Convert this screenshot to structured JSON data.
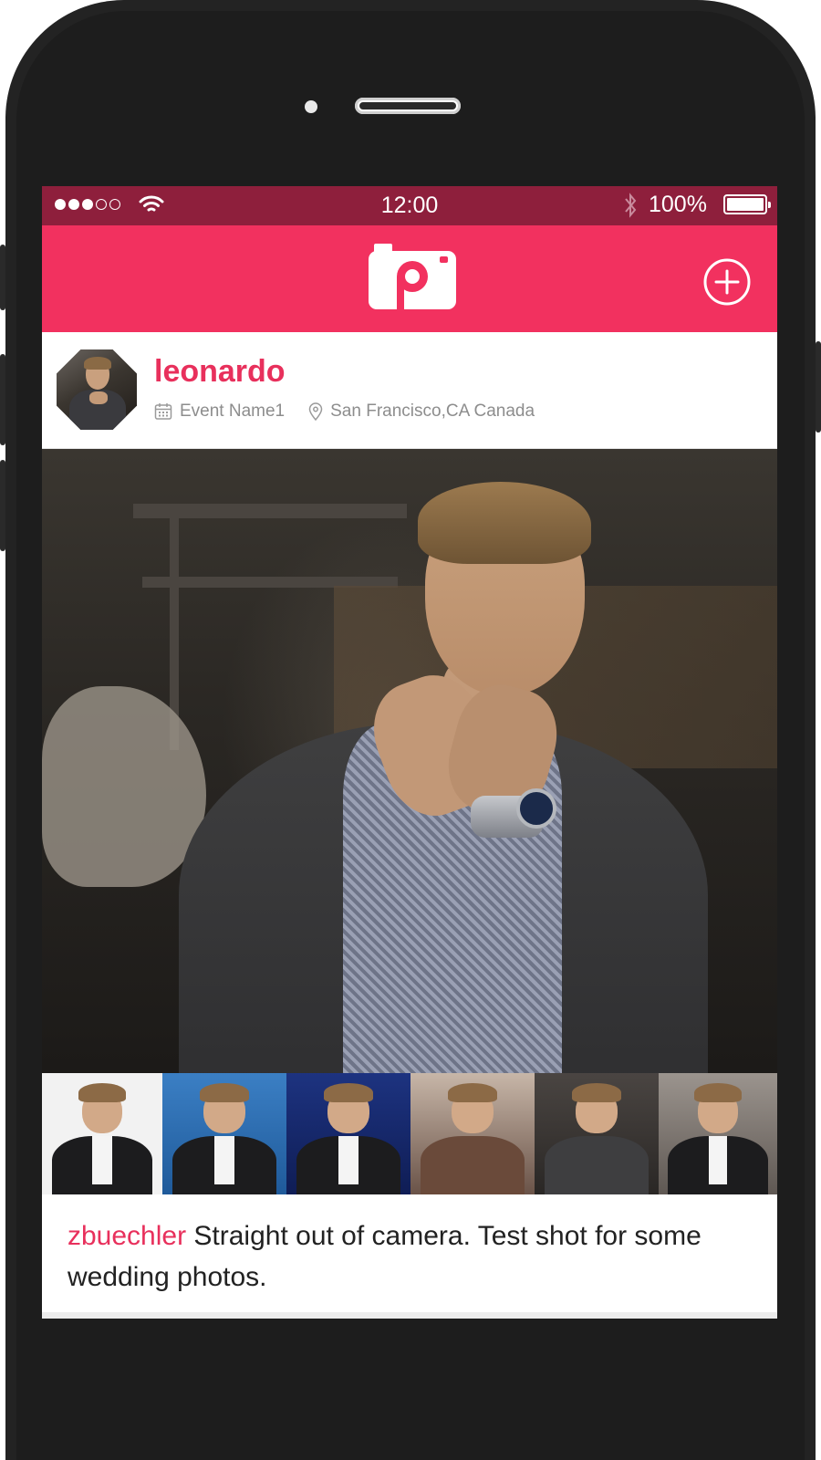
{
  "statusbar": {
    "time": "12:00",
    "battery_text": "100%",
    "signal_filled": 3,
    "signal_total": 5
  },
  "navbar": {
    "logo_icon": "camera-logo-icon",
    "add_icon": "plus-circle-icon",
    "background": "#f2315f"
  },
  "post": {
    "username": "leonardo",
    "event": "Event Name1",
    "location": "San Francisco,CA Canada",
    "caption_user": "zbuechler",
    "caption_text": " Straight out of camera. Test shot for some wedding photos."
  },
  "thumbnails": [
    {
      "bg": "#f2f2f2"
    },
    {
      "bg": "#2f6fb6"
    },
    {
      "bg": "#1a2b6b"
    },
    {
      "bg": "#8a6a5a"
    },
    {
      "bg": "#3a3634"
    },
    {
      "bg": "#7b7570"
    }
  ],
  "colors": {
    "accent": "#e8305c",
    "statusbar": "#8e1f3c"
  }
}
